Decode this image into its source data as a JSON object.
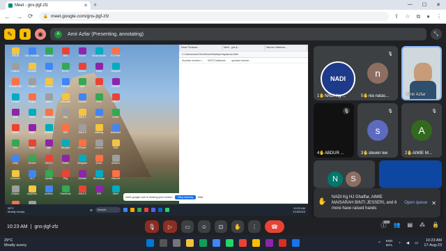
{
  "browser": {
    "tab_title": "Meet - gns-jtgf-zfz",
    "url": "meet.google.com/gns-jtgf-zfz"
  },
  "meet": {
    "presenter_initial": "A",
    "presenting_text": "Amir Azfar (Presenting, annotating)",
    "meeting_code": "gns-jtgf-zfz",
    "time": "10:23 AM",
    "participants_count": "370"
  },
  "shared_screen": {
    "desktop_icons": [
      "GRUB",
      "Gen. Kaedah",
      "efrafkeun",
      "BMI",
      "Ex-ed",
      "Visual Studio",
      "ICT Pres",
      "Outlook",
      "Jawatan",
      "Final",
      "BLOG",
      "Mentor",
      "Excel",
      "Notepad",
      "Recycle Bin",
      "Project",
      "Tourism",
      "Internet",
      "Aidil",
      "CV",
      "iSENSE",
      "Control",
      "Projek",
      "aiden",
      "Microsoft",
      "Chrome",
      "Pres",
      "JPEG 1",
      "Amir",
      "Word",
      "Downloads",
      "Sep",
      "JMUI 1",
      "JMUI 2",
      "Zoom",
      "Teams",
      "Ionic",
      "Android",
      "MSI",
      "JMUI 3",
      "hashtag",
      "keyboard",
      "Fire",
      "Rack",
      "Ajen",
      "Recycle",
      "iPhone",
      "Lenovo",
      "Disk",
      "Unity",
      "Screen",
      "JMUI 4",
      "Flutter",
      "Telegram",
      "Zoom",
      "Arduino",
      "Chrome2",
      "VLC",
      "Spotify",
      "Pkg",
      "Ahmad",
      "WhatsApp",
      "Discord",
      "Eclipse",
      "AnyDesk",
      "archive",
      "Facebook",
      "JMUI 5",
      "RSI",
      "Meet",
      "Discord2",
      "Teams2"
    ],
    "inner_tabs": [
      "Dean Pembant...",
      "Meet - gns-jt...",
      "Narrow Hakeman..."
    ],
    "inner_url": "C:/Users/user/OneDrive/Desktop/hayakuna.html",
    "inner_bookmarks": [
      "Suruhan modern t...",
      "NSTE Databook...",
      "question tutorial..."
    ],
    "share_notice": "meet.google.com is sharing your screen.",
    "stop_sharing": "Stop sharing",
    "hide": "Hide",
    "inner_search": "Search",
    "inner_weather_temp": "28°C",
    "inner_weather_desc": "Mostly cloudy",
    "inner_time": "10:23 AM",
    "inner_date": "1/18/2023"
  },
  "tiles": [
    {
      "label": "NADI Kg ...",
      "prefix": "1",
      "logo": "NADI",
      "bg": "#1e3a8a"
    },
    {
      "label": "nia natas...",
      "prefix": "5",
      "initial": "n",
      "bg": "#8d6e63"
    },
    {
      "label": "Amir Azfar",
      "prefix": ""
    },
    {
      "label": "ABDUR ...",
      "prefix": "4"
    },
    {
      "label": "steven lee",
      "prefix": "3",
      "initial": "s",
      "bg": "#5c6bc0"
    },
    {
      "label": "AIMIE M...",
      "prefix": "2",
      "initial": "A",
      "bg": "#33691e"
    },
    {
      "initial": "N",
      "bg": "#00796b"
    },
    {
      "initial": "S",
      "bg": "#8d6e63"
    }
  ],
  "raised_hands": {
    "text": "NADI Kg HJ Ghaffar, AIMIE MAISARAH BINTI JESSERI, and 6 more have raised hands",
    "action": "Open queue"
  },
  "taskbar": {
    "temp": "29°C",
    "weather": "Mostly sunny",
    "lang": "ENG",
    "region": "INTL",
    "time": "10:23 AM",
    "date": "17-Aug-23"
  },
  "colors": {
    "meet_bg": "#202124",
    "tile_bg": "#3c4043",
    "end_call": "#ea4335",
    "accent_yellow": "#fbbc04",
    "link_blue": "#8ab4f8"
  }
}
